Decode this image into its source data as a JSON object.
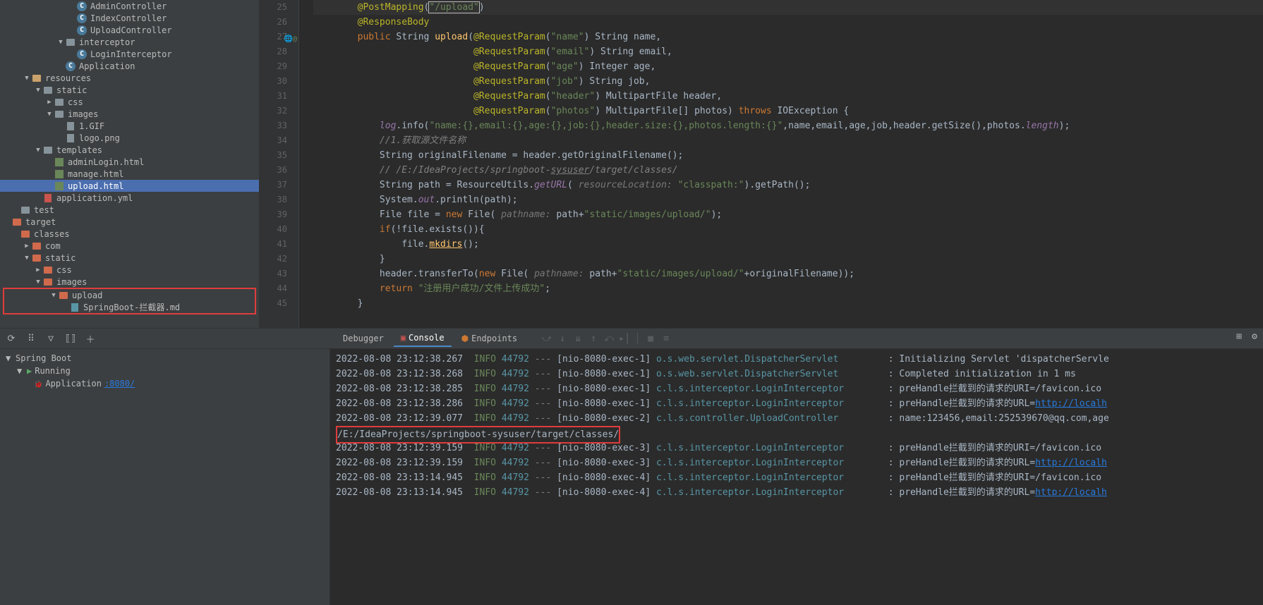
{
  "sidebar": {
    "items": [
      {
        "indent": 6,
        "icon": "class",
        "label": "AdminController",
        "arrow": ""
      },
      {
        "indent": 6,
        "icon": "class",
        "label": "IndexController",
        "arrow": ""
      },
      {
        "indent": 6,
        "icon": "class",
        "label": "UploadController",
        "arrow": ""
      },
      {
        "indent": 5,
        "icon": "folder",
        "label": "interceptor",
        "arrow": "▼"
      },
      {
        "indent": 6,
        "icon": "class",
        "label": "LoginInterceptor",
        "arrow": ""
      },
      {
        "indent": 5,
        "icon": "class",
        "label": "Application",
        "arrow": ""
      },
      {
        "indent": 2,
        "icon": "folder-res",
        "label": "resources",
        "arrow": "▼"
      },
      {
        "indent": 3,
        "icon": "folder",
        "label": "static",
        "arrow": "▼"
      },
      {
        "indent": 4,
        "icon": "folder",
        "label": "css",
        "arrow": "▶"
      },
      {
        "indent": 4,
        "icon": "folder",
        "label": "images",
        "arrow": "▼"
      },
      {
        "indent": 5,
        "icon": "file",
        "label": "1.GIF",
        "arrow": ""
      },
      {
        "indent": 5,
        "icon": "file",
        "label": "logo.png",
        "arrow": ""
      },
      {
        "indent": 3,
        "icon": "folder",
        "label": "templates",
        "arrow": "▼"
      },
      {
        "indent": 4,
        "icon": "html",
        "label": "adminLogin.html",
        "arrow": ""
      },
      {
        "indent": 4,
        "icon": "html",
        "label": "manage.html",
        "arrow": ""
      },
      {
        "indent": 4,
        "icon": "html",
        "label": "upload.html",
        "arrow": "",
        "selected": true
      },
      {
        "indent": 3,
        "icon": "yml",
        "label": "application.yml",
        "arrow": ""
      },
      {
        "indent": 1,
        "icon": "folder",
        "label": "test",
        "arrow": ""
      },
      {
        "indent": 0,
        "icon": "folder-red",
        "label": "target",
        "arrow": ""
      },
      {
        "indent": 1,
        "icon": "folder-red",
        "label": "classes",
        "arrow": ""
      },
      {
        "indent": 2,
        "icon": "folder-red",
        "label": "com",
        "arrow": "▶"
      },
      {
        "indent": 2,
        "icon": "folder-red",
        "label": "static",
        "arrow": "▼"
      },
      {
        "indent": 3,
        "icon": "folder-red",
        "label": "css",
        "arrow": "▶"
      },
      {
        "indent": 3,
        "icon": "folder-red",
        "label": "images",
        "arrow": "▼"
      }
    ],
    "redbox": [
      {
        "indent": 4,
        "icon": "folder-red",
        "label": "upload",
        "arrow": "▼"
      },
      {
        "indent": 5,
        "icon": "md",
        "label": "SpringBoot-拦截器.md",
        "arrow": ""
      }
    ]
  },
  "gutter_start": 25,
  "gutter_icons": {
    "27": "🌐@"
  },
  "code_lines": [
    {
      "n": 25,
      "html": "<span class='anno'>@PostMapping</span>(<span class='str caret-h'>\"/upload\"</span>)",
      "cursor": true
    },
    {
      "n": 26,
      "html": "<span class='anno'>@ResponseBody</span>"
    },
    {
      "n": 27,
      "html": "<span class='kw'>public</span> String <span class='method'>upload</span>(<span class='anno'>@RequestParam</span>(<span class='str'>\"name\"</span>) String name,"
    },
    {
      "n": 28,
      "html": "                     <span class='anno'>@RequestParam</span>(<span class='str'>\"email\"</span>) String email,"
    },
    {
      "n": 29,
      "html": "                     <span class='anno'>@RequestParam</span>(<span class='str'>\"age\"</span>) Integer age,"
    },
    {
      "n": 30,
      "html": "                     <span class='anno'>@RequestParam</span>(<span class='str'>\"job\"</span>) String job,"
    },
    {
      "n": 31,
      "html": "                     <span class='anno'>@RequestParam</span>(<span class='str'>\"header\"</span>) MultipartFile header,"
    },
    {
      "n": 32,
      "html": "                     <span class='anno'>@RequestParam</span>(<span class='str'>\"photos\"</span>) MultipartFile[] photos) <span class='kw'>throws</span> IOException {"
    },
    {
      "n": 33,
      "html": "    <span class='field'>log</span>.info(<span class='str'>\"name:{},email:{},age:{},job:{},header.size:{},photos.length:{}\"</span>,name,email,age,job,header.getSize(),photos.<span class='field'>length</span>);"
    },
    {
      "n": 34,
      "html": "    <span class='comm'>//1.获取源文件名称</span>"
    },
    {
      "n": 35,
      "html": "    String originalFilename = header.getOriginalFilename();"
    },
    {
      "n": 36,
      "html": "    <span class='comm'>// /E:/IdeaProjects/springboot-<span class='u'>sysuser</span>/target/classes/</span>"
    },
    {
      "n": 37,
      "html": "    String path = ResourceUtils.<span class='field'>getURL</span>( <span class='param-hint'>resourceLocation:</span> <span class='str'>\"classpath:\"</span>).getPath();"
    },
    {
      "n": 38,
      "html": "    System.<span class='field'>out</span>.println(path);"
    },
    {
      "n": 39,
      "html": "    File file = <span class='kw'>new</span> File( <span class='param-hint'>pathname:</span> path+<span class='str'>\"static/images/upload/\"</span>);"
    },
    {
      "n": 40,
      "html": "    <span class='kw'>if</span>(!file.exists()){"
    },
    {
      "n": 41,
      "html": "        file.<span class='method u'>mkdirs</span>();"
    },
    {
      "n": 42,
      "html": "    }"
    },
    {
      "n": 43,
      "html": "    header.transferTo(<span class='kw'>new</span> File( <span class='param-hint'>pathname:</span> path+<span class='str'>\"static/images/upload/\"</span>+originalFilename));"
    },
    {
      "n": 44,
      "html": "    <span class='kw'>return</span> <span class='str'>\"注册用户成功/文件上传成功\"</span>;"
    },
    {
      "n": 45,
      "html": "}"
    }
  ],
  "tabs": {
    "debugger": "Debugger",
    "console": "Console",
    "endpoints": "Endpoints"
  },
  "run_panel": {
    "title": "Spring Boot",
    "status": "Running",
    "app": "Application",
    "port": ":8080/"
  },
  "console_lines": [
    {
      "ts": "2022-08-08 23:12:38.267",
      "lvl": "INFO",
      "pid": "44792",
      "th": "[nio-8080-exec-1]",
      "cls": "o.s.web.servlet.DispatcherServlet",
      "msg": "Initializing Servlet 'dispatcherServle"
    },
    {
      "ts": "2022-08-08 23:12:38.268",
      "lvl": "INFO",
      "pid": "44792",
      "th": "[nio-8080-exec-1]",
      "cls": "o.s.web.servlet.DispatcherServlet",
      "msg": "Completed initialization in 1 ms"
    },
    {
      "ts": "2022-08-08 23:12:38.285",
      "lvl": "INFO",
      "pid": "44792",
      "th": "[nio-8080-exec-1]",
      "cls": "c.l.s.interceptor.LoginInterceptor",
      "msg": "preHandle拦截到的请求的URI=/favicon.ico"
    },
    {
      "ts": "2022-08-08 23:12:38.286",
      "lvl": "INFO",
      "pid": "44792",
      "th": "[nio-8080-exec-1]",
      "cls": "c.l.s.interceptor.LoginInterceptor",
      "msg": "preHandle拦截到的请求的URL=",
      "link": "http://localh"
    },
    {
      "ts": "2022-08-08 23:12:39.077",
      "lvl": "INFO",
      "pid": "44792",
      "th": "[nio-8080-exec-2]",
      "cls": "c.l.s.controller.UploadController",
      "msg": "name:123456,email:252539670@qq.com,age"
    },
    {
      "raw": "/E:/IdeaProjects/springboot-sysuser/target/classes/",
      "redbox": true
    },
    {
      "ts": "2022-08-08 23:12:39.159",
      "lvl": "INFO",
      "pid": "44792",
      "th": "[nio-8080-exec-3]",
      "cls": "c.l.s.interceptor.LoginInterceptor",
      "msg": "preHandle拦截到的请求的URI=/favicon.ico"
    },
    {
      "ts": "2022-08-08 23:12:39.159",
      "lvl": "INFO",
      "pid": "44792",
      "th": "[nio-8080-exec-3]",
      "cls": "c.l.s.interceptor.LoginInterceptor",
      "msg": "preHandle拦截到的请求的URL=",
      "link": "http://localh"
    },
    {
      "ts": "2022-08-08 23:13:14.945",
      "lvl": "INFO",
      "pid": "44792",
      "th": "[nio-8080-exec-4]",
      "cls": "c.l.s.interceptor.LoginInterceptor",
      "msg": "preHandle拦截到的请求的URI=/favicon.ico"
    },
    {
      "ts": "2022-08-08 23:13:14.945",
      "lvl": "INFO",
      "pid": "44792",
      "th": "[nio-8080-exec-4]",
      "cls": "c.l.s.interceptor.LoginInterceptor",
      "msg": "preHandle拦截到的请求的URL=",
      "link": "http://localh"
    }
  ]
}
